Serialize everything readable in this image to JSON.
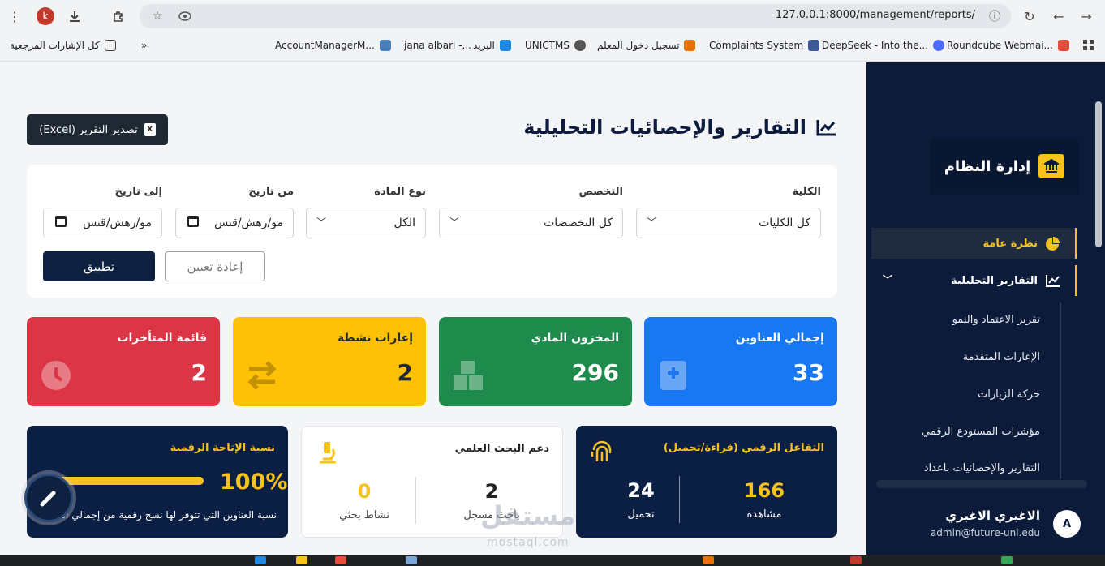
{
  "browser": {
    "profile_initial": "k",
    "url": "127.0.0.1:8000/management/reports/"
  },
  "bookmarks": {
    "all_bookmarks": "كل الإشارات المرجعية",
    "items": [
      {
        "label": "AccountManagerM...",
        "color": "#4a7ebb"
      },
      {
        "label": "jana albari -...",
        "color": "#3d7bd6"
      },
      {
        "label": "البريد",
        "color": "#1e88e5"
      },
      {
        "label": "UNICTMS",
        "color": "#555555"
      },
      {
        "label": "تسجيل دخول المعلم",
        "color": "#e8710a"
      },
      {
        "label": "Complaints System",
        "color": "#3b5998"
      },
      {
        "label": "DeepSeek - Into the...",
        "color": "#4d6bfe"
      },
      {
        "label": "Roundcube Webmai...",
        "color": "#e84c3d"
      }
    ]
  },
  "header": {
    "title": "التقارير والإحصائيات التحليلية",
    "export_label": "تصدير التقرير (Excel)"
  },
  "filters": {
    "college_label": "الكلية",
    "college_value": "كل الكليات",
    "major_label": "التخصص",
    "major_value": "كل التخصصات",
    "type_label": "نوع المادة",
    "type_value": "الكل",
    "from_label": "من تاريخ",
    "from_value": "مو/رهش/قنس",
    "to_label": "إلى تاريخ",
    "to_value": "مو/رهش/قنس",
    "apply_label": "تطبيق",
    "reset_label": "إعادة تعيين"
  },
  "stats": [
    {
      "label": "إجمالي العناوين",
      "value": "33",
      "color": "#1877f2"
    },
    {
      "label": "المخزون المادي",
      "value": "296",
      "color": "#1e8a4c"
    },
    {
      "label": "إعارات نشطة",
      "value": "2",
      "color": "#ffc107"
    },
    {
      "label": "قائمة المتأخرات",
      "value": "2",
      "color": "#dc3545"
    }
  ],
  "digital_interaction": {
    "title": "التفاعل الرقمي (قراءة/تحميل)",
    "views_value": "166",
    "views_label": "مشاهدة",
    "downloads_value": "24",
    "downloads_label": "تحميل"
  },
  "research_support": {
    "title": "دعم البحث العلمي",
    "researchers_value": "2",
    "researchers_label": "باحث مسجل",
    "activity_value": "0",
    "activity_label": "نشاط بحثي"
  },
  "digital_availability": {
    "title": "نسبة الإتاحة الرقمية",
    "percent": "100%",
    "percent_fraction": 1.0,
    "description": "نسبة العناوين التي تتوفر لها نسخ رقمية من إجمالي العناوين."
  },
  "sidebar": {
    "brand": "إدارة النظام",
    "overview": "نظرة عامة",
    "reports": "التقارير التحليلية",
    "sub_items": [
      "تقرير الاعتماد والنمو",
      "الإعارات المتقدمة",
      "حركة الزيارات",
      "مؤشرات المستودع الرقمي",
      "التقارير والإحصائيات باعداد"
    ],
    "user_initial": "A",
    "user_name": "الاغبري الاغبري",
    "user_email": "admin@future-uni.edu"
  },
  "watermark": {
    "arabic": "مستقل",
    "latin": "mostaql.com"
  },
  "colors": {
    "navy": "#0d1b3a",
    "accent": "#f6c21c"
  }
}
